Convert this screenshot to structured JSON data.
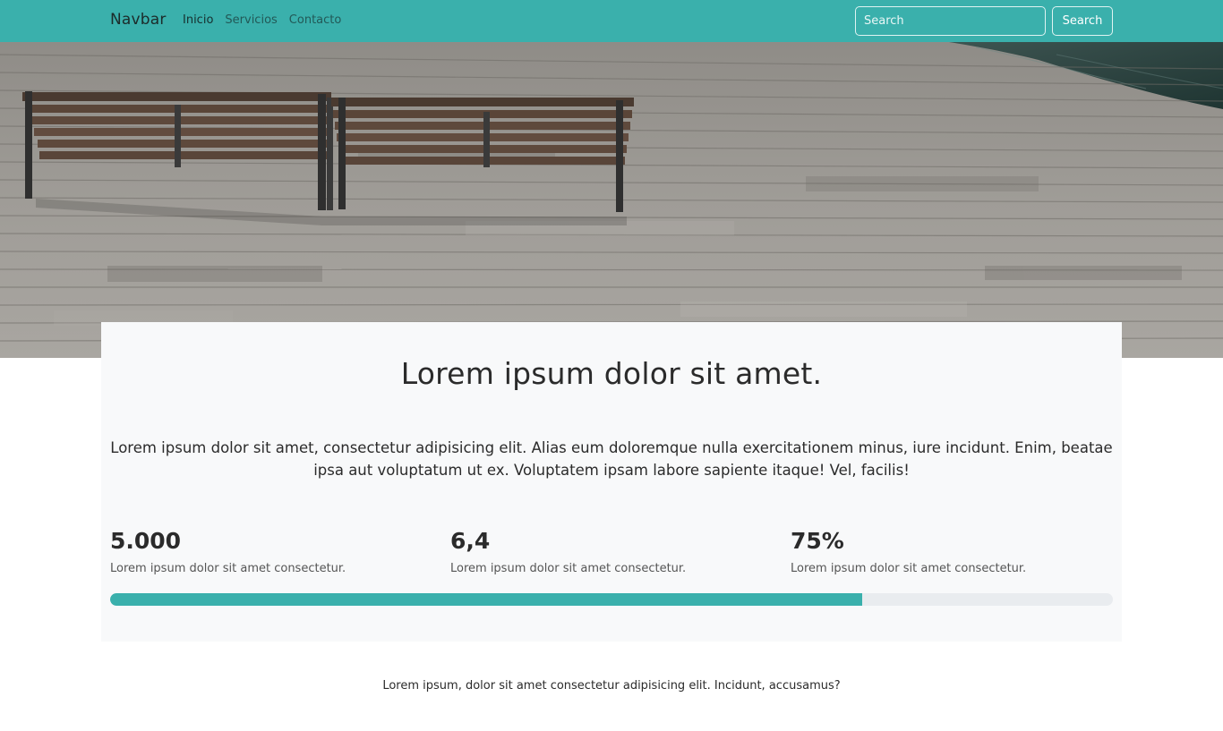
{
  "navbar": {
    "brand": "Navbar",
    "links": [
      {
        "label": "Inicio",
        "active": true
      },
      {
        "label": "Servicios",
        "active": false
      },
      {
        "label": "Contacto",
        "active": false
      }
    ],
    "search_placeholder": "Search",
    "search_button": "Search",
    "background_color": "#3ab0ac"
  },
  "hero": {
    "image_subject": "wooden boardwalk with two park benches next to water"
  },
  "card": {
    "title": "Lorem ipsum dolor sit amet.",
    "lead": "Lorem ipsum dolor sit amet, consectetur adipisicing elit. Alias eum doloremque nulla exercitationem minus, iure incidunt. Enim, beatae ipsa aut voluptatum ut ex. Voluptatem ipsam labore sapiente itaque! Vel, facilis!",
    "stats": [
      {
        "value": "5.000",
        "description": "Lorem ipsum dolor sit amet consectetur."
      },
      {
        "value": "6,4",
        "description": "Lorem ipsum dolor sit amet consectetur."
      },
      {
        "value": "75%",
        "description": "Lorem ipsum dolor sit amet consectetur."
      }
    ],
    "progress_percent": 75,
    "progress_color": "#3ab0ac"
  },
  "footer": {
    "text": "Lorem ipsum, dolor sit amet consectetur adipisicing elit. Incidunt, accusamus?"
  }
}
